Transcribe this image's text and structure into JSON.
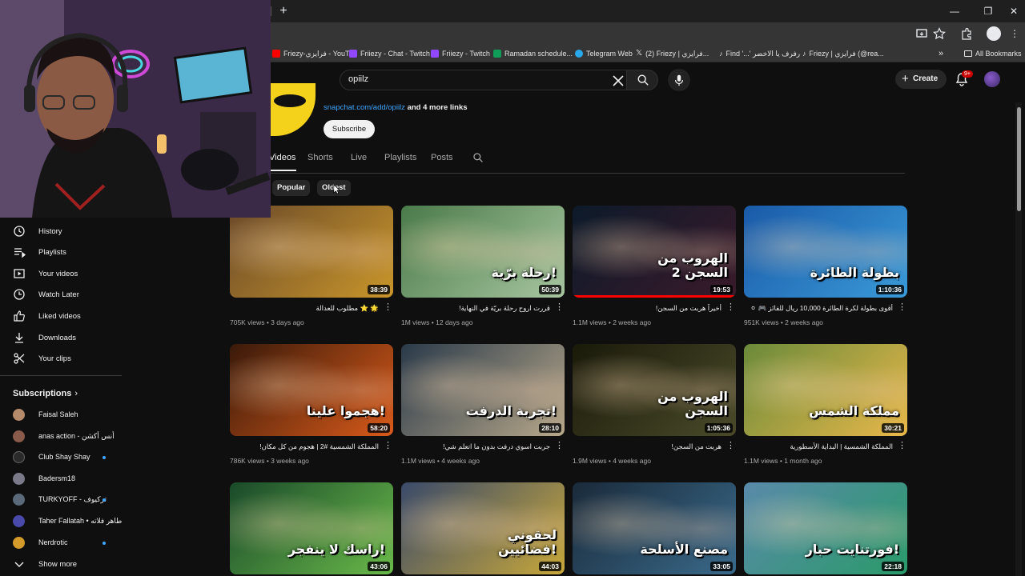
{
  "browser": {
    "window_controls": {
      "minimize": "—",
      "restore": "❐",
      "close": "✕"
    },
    "new_tab_label": "+",
    "bookmarks": [
      {
        "label": "Friezy-فرايزي - YouT...",
        "color": "#ff0000"
      },
      {
        "label": "Friiezy - Chat - Twitch",
        "color": "#9146ff"
      },
      {
        "label": "Friiezy - Twitch",
        "color": "#9146ff"
      },
      {
        "label": "Ramadan schedule...",
        "color": "#0f9d58"
      },
      {
        "label": "Telegram Web",
        "color": "#29a9eb"
      },
      {
        "label": "(2) Friezy | فرايزي...",
        "color": "#000000"
      },
      {
        "label": "Find '...' رفرف يا الاخضر",
        "color": "#000000"
      },
      {
        "label": "Friezy | فرايزي (@rea...",
        "color": "#000000"
      }
    ],
    "more_bookmarks": "»",
    "all_bookmarks": "All Bookmarks"
  },
  "header": {
    "search_value": "opiilz",
    "create_label": "Create",
    "notification_badge": "9+"
  },
  "channel": {
    "links_url": "snapchat.com/add/opiilz",
    "links_more": "and 4 more links",
    "subscribe_label": "Subscribe",
    "tabs": [
      "Videos",
      "Shorts",
      "Live",
      "Playlists",
      "Posts"
    ],
    "active_tab": "Videos",
    "chips": [
      "Popular",
      "Oldest"
    ]
  },
  "sidebar": {
    "items": [
      {
        "label": "History",
        "icon": "history-icon"
      },
      {
        "label": "Playlists",
        "icon": "playlists-icon"
      },
      {
        "label": "Your videos",
        "icon": "your-videos-icon"
      },
      {
        "label": "Watch Later",
        "icon": "watch-later-icon"
      },
      {
        "label": "Liked videos",
        "icon": "like-icon"
      },
      {
        "label": "Downloads",
        "icon": "download-icon"
      },
      {
        "label": "Your clips",
        "icon": "scissors-icon"
      }
    ],
    "subscriptions_title": "Subscriptions",
    "subscriptions_chevron": "›",
    "subscriptions": [
      {
        "name": "Faisal Saleh",
        "color": "#b58a6a",
        "live": false
      },
      {
        "name": "anas action - أنس أكشن",
        "color": "#8a5a4a",
        "live": false
      },
      {
        "name": "Club Shay Shay",
        "color": "#2a2a2a",
        "live": true
      },
      {
        "name": "Badersm18",
        "color": "#7a7a8a",
        "live": false
      },
      {
        "name": "TURKYOFF - تركيوف",
        "color": "#5a6a7a",
        "live": true
      },
      {
        "name": "Taher Fallatah • طاهر فلاته",
        "color": "#4a4aaa",
        "live": false
      },
      {
        "name": "Nerdrotic",
        "color": "#d49a2a",
        "live": true
      }
    ],
    "show_more": "Show more"
  },
  "videos": [
    {
      "title": "🌟 ⭐ مطلوب للعدالة",
      "views": "705K views",
      "age": "3 days ago",
      "duration": "38:39",
      "thumb_text": "",
      "bg1": "#6b4a2a",
      "bg2": "#c9962a",
      "progress": 0
    },
    {
      "title": "قررت اروح رحلة بريّة في النهاية!",
      "views": "1M views",
      "age": "12 days ago",
      "duration": "50:39",
      "thumb_text": "رحلة برّية!",
      "bg1": "#4a7a4a",
      "bg2": "#a8c6a0",
      "progress": 0
    },
    {
      "title": "أخيراً هربت من السجن!",
      "views": "1.1M views",
      "age": "2 weeks ago",
      "duration": "19:53",
      "thumb_text": "الهروب من السجن 2",
      "bg1": "#0c1a2a",
      "bg2": "#3a1a2a",
      "progress": 1
    },
    {
      "title": "أقوى بطولة لكرة الطائرة 10,000 ريال للفائز 🎮 ⚪",
      "views": "951K views",
      "age": "2 weeks ago",
      "duration": "1:10:36",
      "thumb_text": "بطولة الطائرة",
      "bg1": "#1a5aa8",
      "bg2": "#3a9ad8",
      "progress": 0
    },
    {
      "title": "المملكة الشمسية #2 | هجوم من كل مكان!",
      "views": "786K views",
      "age": "3 weeks ago",
      "duration": "58:20",
      "thumb_text": "هجموا علينا!",
      "bg1": "#3a1a0a",
      "bg2": "#d85a1a",
      "progress": 0
    },
    {
      "title": "جربت اسوي درفت بدون ما اتعلم شي!",
      "views": "1.1M views",
      "age": "4 weeks ago",
      "duration": "28:10",
      "thumb_text": "تجربة الدرفت!",
      "bg1": "#2a3a4a",
      "bg2": "#b8a88a",
      "progress": 0
    },
    {
      "title": "هربت من السجن!",
      "views": "1.9M views",
      "age": "4 weeks ago",
      "duration": "1:05:36",
      "thumb_text": "الهروب من السجن",
      "bg1": "#1a1a0a",
      "bg2": "#4a4a2a",
      "progress": 0
    },
    {
      "title": "المملكة الشمسية | البداية الأسطورية",
      "views": "1.1M views",
      "age": "1 month ago",
      "duration": "30:21",
      "thumb_text": "مملكة الشمس",
      "bg1": "#6a8a3a",
      "bg2": "#e8b84a",
      "progress": 0
    },
    {
      "title": "",
      "views": "",
      "age": "",
      "duration": "43:06",
      "thumb_text": "راسك لا ينفجر!",
      "bg1": "#1a4a2a",
      "bg2": "#6aba4a",
      "progress": 0
    },
    {
      "title": "",
      "views": "",
      "age": "",
      "duration": "44:03",
      "thumb_text": "لحقوني فضائيين!",
      "bg1": "#3a4a6a",
      "bg2": "#c8a83a",
      "progress": 0
    },
    {
      "title": "",
      "views": "",
      "age": "",
      "duration": "33:05",
      "thumb_text": "مصنع الأسلحة",
      "bg1": "#1a2a3a",
      "bg2": "#3a6a8a",
      "progress": 0
    },
    {
      "title": "",
      "views": "",
      "age": "",
      "duration": "22:18",
      "thumb_text": "فورتنايت حبار!",
      "bg1": "#5a8aaa",
      "bg2": "#2a9a6a",
      "progress": 0
    }
  ],
  "colors": {
    "accent": "#3ea6ff",
    "live_red": "#ff0000",
    "background": "#0f0f0f"
  }
}
